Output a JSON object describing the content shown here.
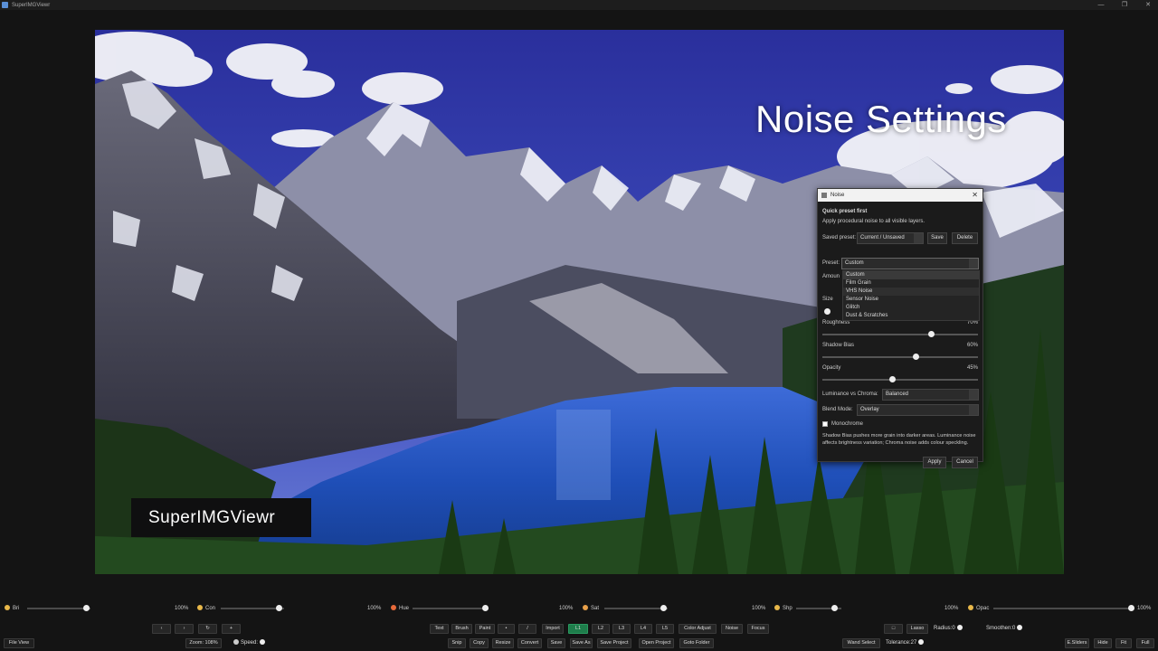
{
  "window": {
    "title": "SuperIMGViewr",
    "controls": [
      "—",
      "❐",
      "✕"
    ]
  },
  "viewer": {
    "overlay_title": "Noise Settings",
    "brand": "SuperIMGViewr"
  },
  "dialog": {
    "title": "Noise",
    "heading": "Quick preset first",
    "subtitle": "Apply procedural noise to all visible layers.",
    "saved_preset_label": "Saved preset:",
    "saved_preset_value": "Current / Unsaved",
    "save_label": "Save",
    "delete_label": "Delete",
    "preset_label": "Preset:",
    "preset_value": "Custom",
    "preset_options": [
      "Custom",
      "Film Grain",
      "VHS Noise",
      "Sensor Noise",
      "Glitch",
      "Dust & Scratches"
    ],
    "amount_label": "Amoun",
    "size_label": "Size",
    "sliders": [
      {
        "label": "Roughness",
        "value_text": "70%",
        "value": 0.7
      },
      {
        "label": "Shadow Bias",
        "value_text": "60%",
        "value": 0.6
      },
      {
        "label": "Opacity",
        "value_text": "45%",
        "value": 0.45
      }
    ],
    "lum_chroma_label": "Luminance vs Chroma:",
    "lum_chroma_value": "Balanced",
    "blend_label": "Blend Mode:",
    "blend_value": "Overlay",
    "monochrome_label": "Monochrome",
    "monochrome_checked": false,
    "note": "Shadow Bias pushes more grain into darker areas. Luminance noise affects brightness variation; Chroma noise adds colour speckling.",
    "apply_label": "Apply",
    "cancel_label": "Cancel"
  },
  "adjust_sliders": [
    {
      "label": "Bri",
      "value_text": "100%",
      "icon": "sun-icon",
      "color": "#e8b84a"
    },
    {
      "label": "Con",
      "value_text": "100%",
      "icon": "contrast-icon",
      "color": "#e8b84a"
    },
    {
      "label": "Hue",
      "value_text": "100%",
      "icon": "hue-icon",
      "color": "#e86a3a"
    },
    {
      "label": "Sat",
      "value_text": "100%",
      "icon": "saturation-icon",
      "color": "#e8a04a"
    },
    {
      "label": "Shp",
      "value_text": "100%",
      "icon": "sharpen-icon",
      "color": "#e8b84a"
    },
    {
      "label": "Opac",
      "value_text": "100%",
      "icon": "opacity-icon",
      "color": "#e8b84a"
    }
  ],
  "toolbar_row1": {
    "nav": [
      "‹",
      "›",
      "↻",
      "+"
    ],
    "tools": [
      "Text",
      "Brush",
      "Paint",
      "•",
      "/"
    ],
    "layers": [
      "Import",
      "L1",
      "L2",
      "L3",
      "L4",
      "L5"
    ],
    "actions": [
      "Color Adjust",
      "Noise",
      "Focus"
    ],
    "right": [
      "□",
      "Lasso"
    ],
    "radius_label": "Radius:0",
    "smoothen_label": "Smoothen:0"
  },
  "toolbar_row2": {
    "file_view": "File View",
    "zoom": "Zoom: 108%",
    "speed_label": "Speed:",
    "actions": [
      "Snip",
      "Copy",
      "Resize",
      "Convert",
      "Save",
      "Save As",
      "Save Project",
      "Open Project",
      "Goto Folder"
    ],
    "wand": "Wand Select",
    "tolerance": "Tolerance:27",
    "right": [
      "E.Sliders",
      "Hide",
      "Fit",
      "Full"
    ]
  },
  "colors": {
    "active_layer": "#1e7d4b",
    "background": "#141414",
    "sky": "#2f3aa0"
  }
}
